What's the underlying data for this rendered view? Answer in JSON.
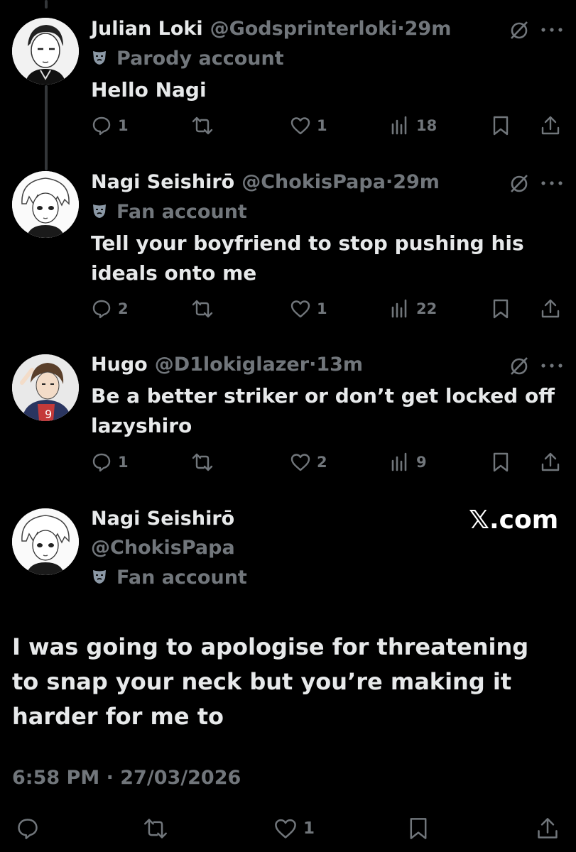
{
  "replies": [
    {
      "name": "Julian Loki",
      "handle": "@Godsprinterloki",
      "sep": "·",
      "time": "29m",
      "badge": "Parody account",
      "text": "Hello Nagi",
      "stats": {
        "replies": "1",
        "reposts": "",
        "likes": "1",
        "views": "18"
      }
    },
    {
      "name": "Nagi Seishirō",
      "handle": "@ChokisPapa",
      "sep": "·",
      "time": "29m",
      "badge": "Fan account",
      "text": "Tell your boyfriend to stop pushing his ideals onto me",
      "stats": {
        "replies": "2",
        "reposts": "",
        "likes": "1",
        "views": "22"
      }
    },
    {
      "name": "Hugo",
      "handle": "@D1lokiglazer",
      "sep": "·",
      "time": "13m",
      "badge": "",
      "text": "Be a better striker or don’t get locked off lazyshiro",
      "stats": {
        "replies": "1",
        "reposts": "",
        "likes": "2",
        "views": "9"
      }
    }
  ],
  "main": {
    "name": "Nagi Seishirō",
    "handle": "@ChokisPapa",
    "badge": "Fan account",
    "watermark": "𝕏.com",
    "text": "I was going to apologise for threatening to snap your neck but you’re making it harder for me to",
    "timestamp": "6:58 PM · 27/03/2026",
    "stats": {
      "likes": "1"
    }
  },
  "icons": {
    "reply": "reply-icon",
    "repost": "repost-icon",
    "like": "heart-icon",
    "views": "views-icon",
    "bookmark": "bookmark-icon",
    "share": "share-icon",
    "grok": "grok-icon",
    "more": "more-icon",
    "mask": "mask-badge-icon"
  },
  "colors": {
    "background": "#000000",
    "primary_text": "#e7e9ea",
    "secondary_text": "#71767b",
    "thread_line": "#333639"
  }
}
